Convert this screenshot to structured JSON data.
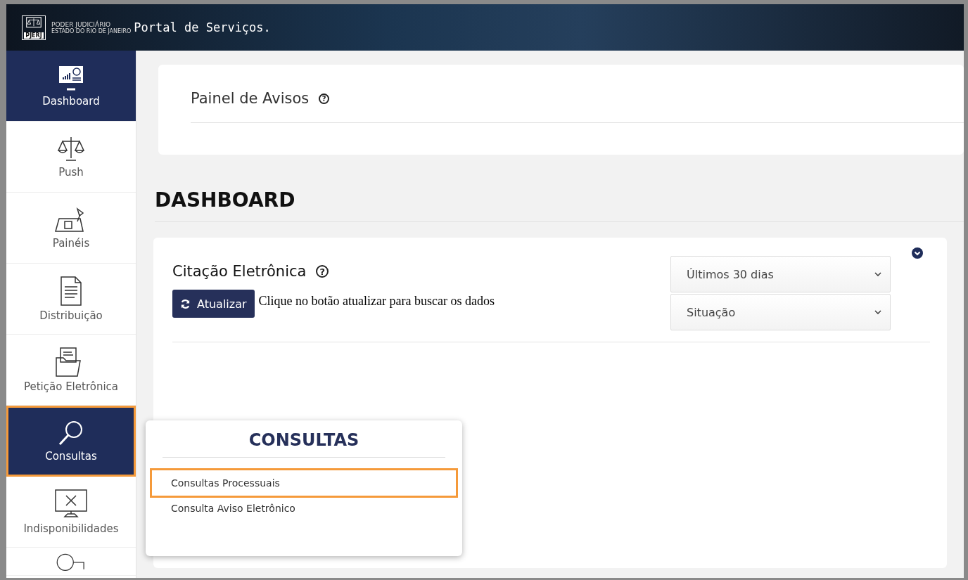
{
  "header": {
    "logo_mark": "PJERJ",
    "logo_line_1": "PODER JUDICIÁRIO",
    "logo_line_2": "ESTADO DO RIO DE JANEIRO",
    "title": "Portal de Serviços."
  },
  "sidebar": {
    "items": [
      {
        "label": "Dashboard",
        "kind": "dashboard",
        "selected": true,
        "highlighted": false
      },
      {
        "label": "Push",
        "kind": "scales",
        "selected": false,
        "highlighted": false
      },
      {
        "label": "Painéis",
        "kind": "desk",
        "selected": false,
        "highlighted": false
      },
      {
        "label": "Distribuição",
        "kind": "document",
        "selected": false,
        "highlighted": false
      },
      {
        "label": "Petição Eletrônica",
        "kind": "folder",
        "selected": false,
        "highlighted": false
      },
      {
        "label": "Consultas",
        "kind": "search",
        "selected": true,
        "highlighted": true
      },
      {
        "label": "Indisponibilidades",
        "kind": "monitor",
        "selected": false,
        "highlighted": false
      },
      {
        "kind": "help",
        "selected": false,
        "highlighted": false
      }
    ]
  },
  "notice_panel": {
    "title": "Painel de Avisos",
    "help": "?"
  },
  "page_title": "DASHBOARD",
  "card": {
    "title": "Citação Eletrônica",
    "help": "?",
    "refresh_button": "Atualizar",
    "hint": "Clique no botão atualizar para buscar os dados",
    "filters": [
      {
        "value": "Últimos 30 dias"
      },
      {
        "value": "Situação"
      }
    ]
  },
  "popup_menu": {
    "title": "CONSULTAS",
    "items": [
      {
        "label": "Consultas Processuais",
        "highlighted": true
      },
      {
        "label": "Consulta Aviso Eletrônico",
        "highlighted": false
      }
    ]
  }
}
